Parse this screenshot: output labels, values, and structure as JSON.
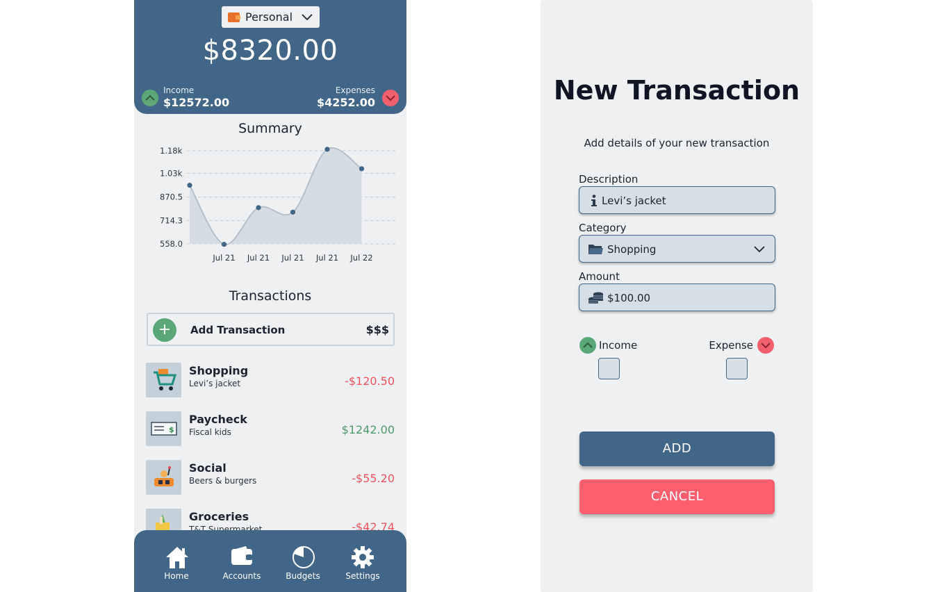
{
  "home": {
    "account_selector": "Personal",
    "balance": "$8320.00",
    "income_label": "Income",
    "income_value": "$12572.00",
    "expenses_label": "Expenses",
    "expenses_value": "$4252.00",
    "summary_title": "Summary",
    "transactions_title": "Transactions",
    "add_transaction_label": "Add Transaction",
    "add_transaction_symbol": "$$$",
    "transactions": [
      {
        "category": "Shopping",
        "description": "Levi’s jacket",
        "amount": "-$120.50",
        "type": "expense",
        "icon": "shopping-cart-icon"
      },
      {
        "category": "Paycheck",
        "description": "Fiscal kids",
        "amount": "$1242.00",
        "type": "income",
        "icon": "cheque-icon"
      },
      {
        "category": "Social",
        "description": "Beers & burgers",
        "amount": "-$55.20",
        "type": "expense",
        "icon": "party-icon"
      },
      {
        "category": "Groceries",
        "description": "T&T Supermarket",
        "amount": "-$42.74",
        "type": "expense",
        "icon": "grocery-bag-icon"
      }
    ],
    "nav": [
      {
        "label": "Home",
        "icon": "home-icon"
      },
      {
        "label": "Accounts",
        "icon": "wallet-icon"
      },
      {
        "label": "Budgets",
        "icon": "pie-chart-icon"
      },
      {
        "label": "Settings",
        "icon": "gear-icon"
      }
    ]
  },
  "chart_data": {
    "type": "area",
    "title": "Summary",
    "categories": [
      "",
      "Jul 21",
      "Jul 21",
      "Jul 21",
      "Jul 21",
      "Jul 22"
    ],
    "values": [
      950,
      555,
      800,
      770,
      1190,
      1060
    ],
    "yticks": [
      558.0,
      714.3,
      870.5,
      1030,
      1180
    ],
    "ytick_labels": [
      "558.0",
      "714.3",
      "870.5",
      "1.03k",
      "1.18k"
    ],
    "ylim": [
      558.0,
      1180
    ],
    "grid": true
  },
  "form": {
    "title": "New Transaction",
    "subtitle": "Add details of your new transaction",
    "description_label": "Description",
    "description_value": "Levi’s jacket",
    "category_label": "Category",
    "category_value": "Shopping",
    "amount_label": "Amount",
    "amount_value": "$100.00",
    "income_label": "Income",
    "expense_label": "Expense",
    "add_button": "ADD",
    "cancel_button": "CANCEL"
  },
  "colors": {
    "primary": "#416688",
    "income": "#5ca778",
    "expense": "#f2606e",
    "background": "#eef0f2"
  }
}
